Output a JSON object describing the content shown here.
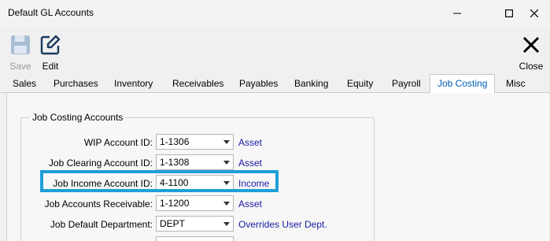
{
  "window": {
    "title": "Default GL Accounts"
  },
  "toolbar": {
    "save_label": "Save",
    "edit_label": "Edit",
    "close_label": "Close"
  },
  "tabs": [
    {
      "label": "Sales"
    },
    {
      "label": "Purchases"
    },
    {
      "label": "Inventory"
    },
    {
      "label": "Receivables"
    },
    {
      "label": "Payables"
    },
    {
      "label": "Banking"
    },
    {
      "label": "Equity"
    },
    {
      "label": "Payroll"
    },
    {
      "label": "Job Costing"
    },
    {
      "label": "Misc"
    }
  ],
  "active_tab": "Job Costing",
  "group": {
    "title": "Job Costing Accounts",
    "rows": [
      {
        "label": "WIP Account ID:",
        "value": "1-1306",
        "link": "Asset"
      },
      {
        "label": "Job Clearing Account ID:",
        "value": "1-1308",
        "link": "Asset"
      },
      {
        "label": "Job Income Account ID:",
        "value": "4-1100",
        "link": "Income"
      },
      {
        "label": "Job Accounts Receivable:",
        "value": "1-1200",
        "link": "Asset"
      },
      {
        "label": "Job Default Department:",
        "value": "DEPT",
        "link": "Overrides User Dept."
      }
    ]
  },
  "colors": {
    "highlight": "#1e9fd8",
    "link": "#1a1aa6",
    "active_tab_text": "#005fb8"
  }
}
